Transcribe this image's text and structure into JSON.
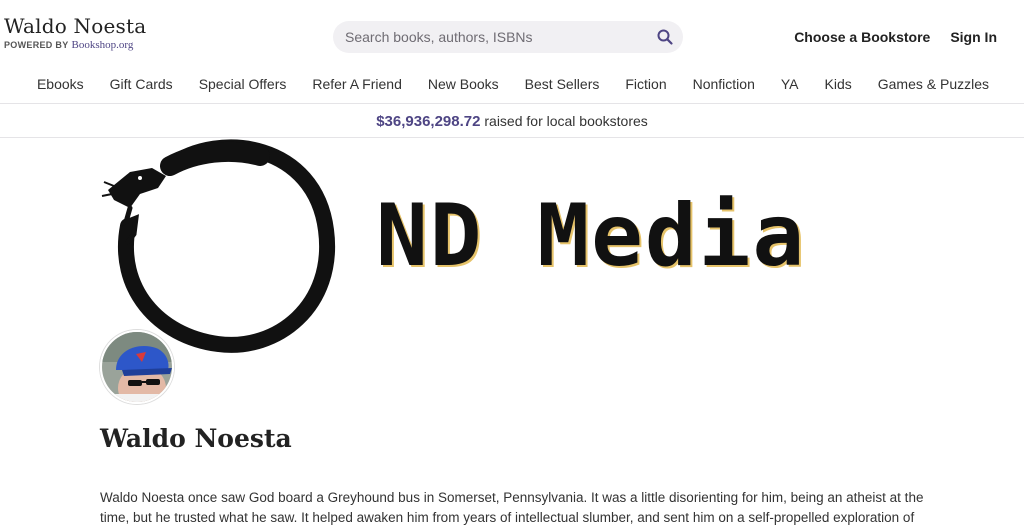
{
  "header": {
    "store_name": "Waldo Noesta",
    "powered_by": "POWERED BY",
    "powered_brand": "Bookshop.org",
    "search_placeholder": "Search books, authors, ISBNs",
    "search_icon": "search-icon",
    "choose_bookstore": "Choose a Bookstore",
    "sign_in": "Sign In"
  },
  "nav": {
    "items": [
      {
        "label": "Ebooks"
      },
      {
        "label": "Gift Cards"
      },
      {
        "label": "Special Offers"
      },
      {
        "label": "Refer A Friend"
      },
      {
        "label": "New Books"
      },
      {
        "label": "Best Sellers"
      },
      {
        "label": "Fiction"
      },
      {
        "label": "Nonfiction"
      },
      {
        "label": "YA"
      },
      {
        "label": "Kids"
      },
      {
        "label": "Games & Puzzles"
      }
    ]
  },
  "raised": {
    "amount": "$36,936,298.72",
    "text": "raised for local bookstores"
  },
  "banner": {
    "text": "ND Media",
    "logo_icon": "ouroboros-icon",
    "colors": {
      "ink": "#111111",
      "accent_shadow": "#e6c36a"
    }
  },
  "profile": {
    "name": "Waldo Noesta",
    "bio": "Waldo Noesta once saw God board a Greyhound bus in Somerset, Pennsylvania. It was a little disorienting for him, being an atheist at the time, but he trusted what he saw. It helped awaken him from years of intellectual slumber, and sent him on a self-propelled exploration of"
  },
  "colors": {
    "brand_purple": "#4e4584",
    "search_bg": "#f1f0f3",
    "divider": "#e5e4e7"
  }
}
